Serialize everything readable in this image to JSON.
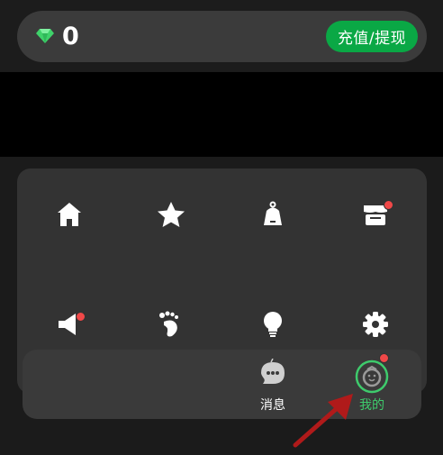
{
  "wallet": {
    "balance": "0",
    "recharge_label": "充值/提现",
    "gem_icon": "diamond-icon",
    "accent": "#0aa845"
  },
  "grid": {
    "items": [
      {
        "icon": "home-icon",
        "badge": false
      },
      {
        "icon": "star-icon",
        "badge": false
      },
      {
        "icon": "bell-icon",
        "badge": false
      },
      {
        "icon": "store-icon",
        "badge": true
      },
      {
        "icon": "megaphone-icon",
        "badge": true
      },
      {
        "icon": "footprints-icon",
        "badge": false
      },
      {
        "icon": "lightbulb-icon",
        "badge": false
      },
      {
        "icon": "gear-icon",
        "badge": false
      }
    ]
  },
  "bottom_nav": {
    "messages_label": "消息",
    "me_label": "我的",
    "me_badge": true,
    "active_color": "#3ecb6c"
  },
  "badge_color": "#f04848"
}
